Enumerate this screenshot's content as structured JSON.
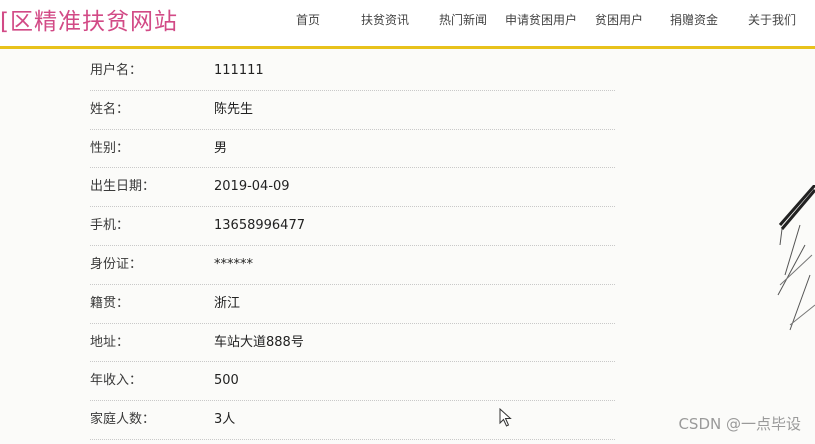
{
  "site": {
    "title": "[区精准扶贫网站"
  },
  "nav": {
    "items": [
      {
        "label": "首页"
      },
      {
        "label": "扶贫资讯"
      },
      {
        "label": "热门新闻"
      },
      {
        "label": "申请贫困用户"
      },
      {
        "label": "贫困用户"
      },
      {
        "label": "捐赠资金"
      },
      {
        "label": "关于我们"
      }
    ]
  },
  "profile": {
    "rows": [
      {
        "label": "用户名：",
        "value": "111111"
      },
      {
        "label": "姓名：",
        "value": "陈先生"
      },
      {
        "label": "性别：",
        "value": "男"
      },
      {
        "label": "出生日期：",
        "value": "2019-04-09"
      },
      {
        "label": "手机：",
        "value": "13658996477"
      },
      {
        "label": "身份证：",
        "value": "******"
      },
      {
        "label": "籍贯：",
        "value": "浙江"
      },
      {
        "label": "地址：",
        "value": "车站大道888号"
      },
      {
        "label": "年收入：",
        "value": "500"
      },
      {
        "label": "家庭人数：",
        "value": "3人"
      }
    ]
  },
  "watermark": "CSDN @一点毕设",
  "colors": {
    "title": "#d24a86",
    "accent_line": "#e8c21b"
  }
}
